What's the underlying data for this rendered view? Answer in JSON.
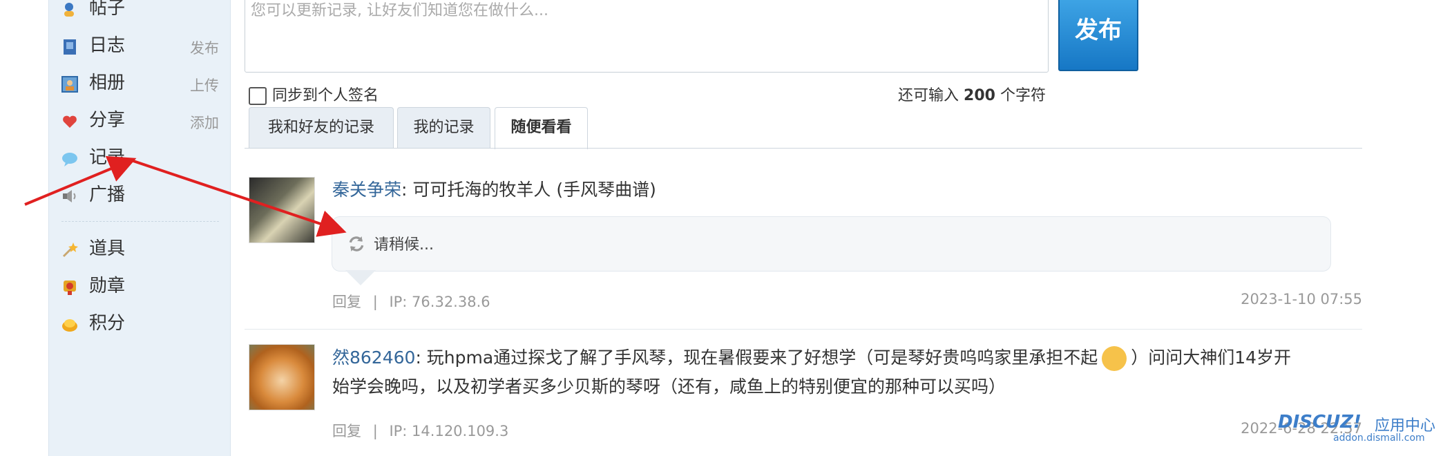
{
  "sidebar": {
    "items": [
      {
        "label": "帖子",
        "action": "",
        "icon": "user-pen-icon"
      },
      {
        "label": "日志",
        "action": "发布",
        "icon": "blog-book-icon"
      },
      {
        "label": "相册",
        "action": "上传",
        "icon": "album-icon"
      },
      {
        "label": "分享",
        "action": "添加",
        "icon": "share-heart-icon"
      },
      {
        "label": "记录",
        "action": "",
        "icon": "speech-bubble-icon"
      },
      {
        "label": "广播",
        "action": "",
        "icon": "speaker-icon"
      },
      {
        "label": "道具",
        "action": "",
        "icon": "magic-wand-icon"
      },
      {
        "label": "勋章",
        "action": "",
        "icon": "medal-icon"
      },
      {
        "label": "积分",
        "action": "",
        "icon": "gold-coin-icon"
      }
    ]
  },
  "composer": {
    "placeholder": "您可以更新记录, 让好友们知道您在做什么...",
    "publish_label": "发布",
    "sync_label": "同步到个人签名",
    "counter_prefix": "还可输入",
    "counter_value": "200",
    "counter_suffix": "个字符"
  },
  "tabs": [
    {
      "label": "我和好友的记录",
      "active": false
    },
    {
      "label": "我的记录",
      "active": false
    },
    {
      "label": "随便看看",
      "active": true
    }
  ],
  "posts": [
    {
      "user": "秦关争荣",
      "text": ": 可可托海的牧羊人 (手风琴曲谱)",
      "loading": "请稍候...",
      "reply": "回复",
      "sep": "|",
      "ip": "IP: 76.32.38.6",
      "date": "2023-1-10 07:55"
    },
    {
      "user": "然862460",
      "text_before": ": 玩hpma通过探戈了解了手风琴，现在暑假要来了好想学（可是琴好贵呜呜家里承担不起",
      "text_after": "）问问大神们14岁开",
      "text_line2": "始学会晚吗，以及初学者买多少贝斯的琴呀（还有，咸鱼上的特别便宜的那种可以买吗）",
      "reply": "回复",
      "sep": "|",
      "ip": "IP: 14.120.109.3",
      "date": "2022-6-28 22:57"
    }
  ],
  "watermark": {
    "brand": "DISCUZ!",
    "label": "应用中心",
    "url": "addon.dismall.com"
  },
  "colors": {
    "link": "#336699",
    "publish": "#1b82d1",
    "arrow": "#e02020",
    "sidebar": "#e9f1f8"
  }
}
